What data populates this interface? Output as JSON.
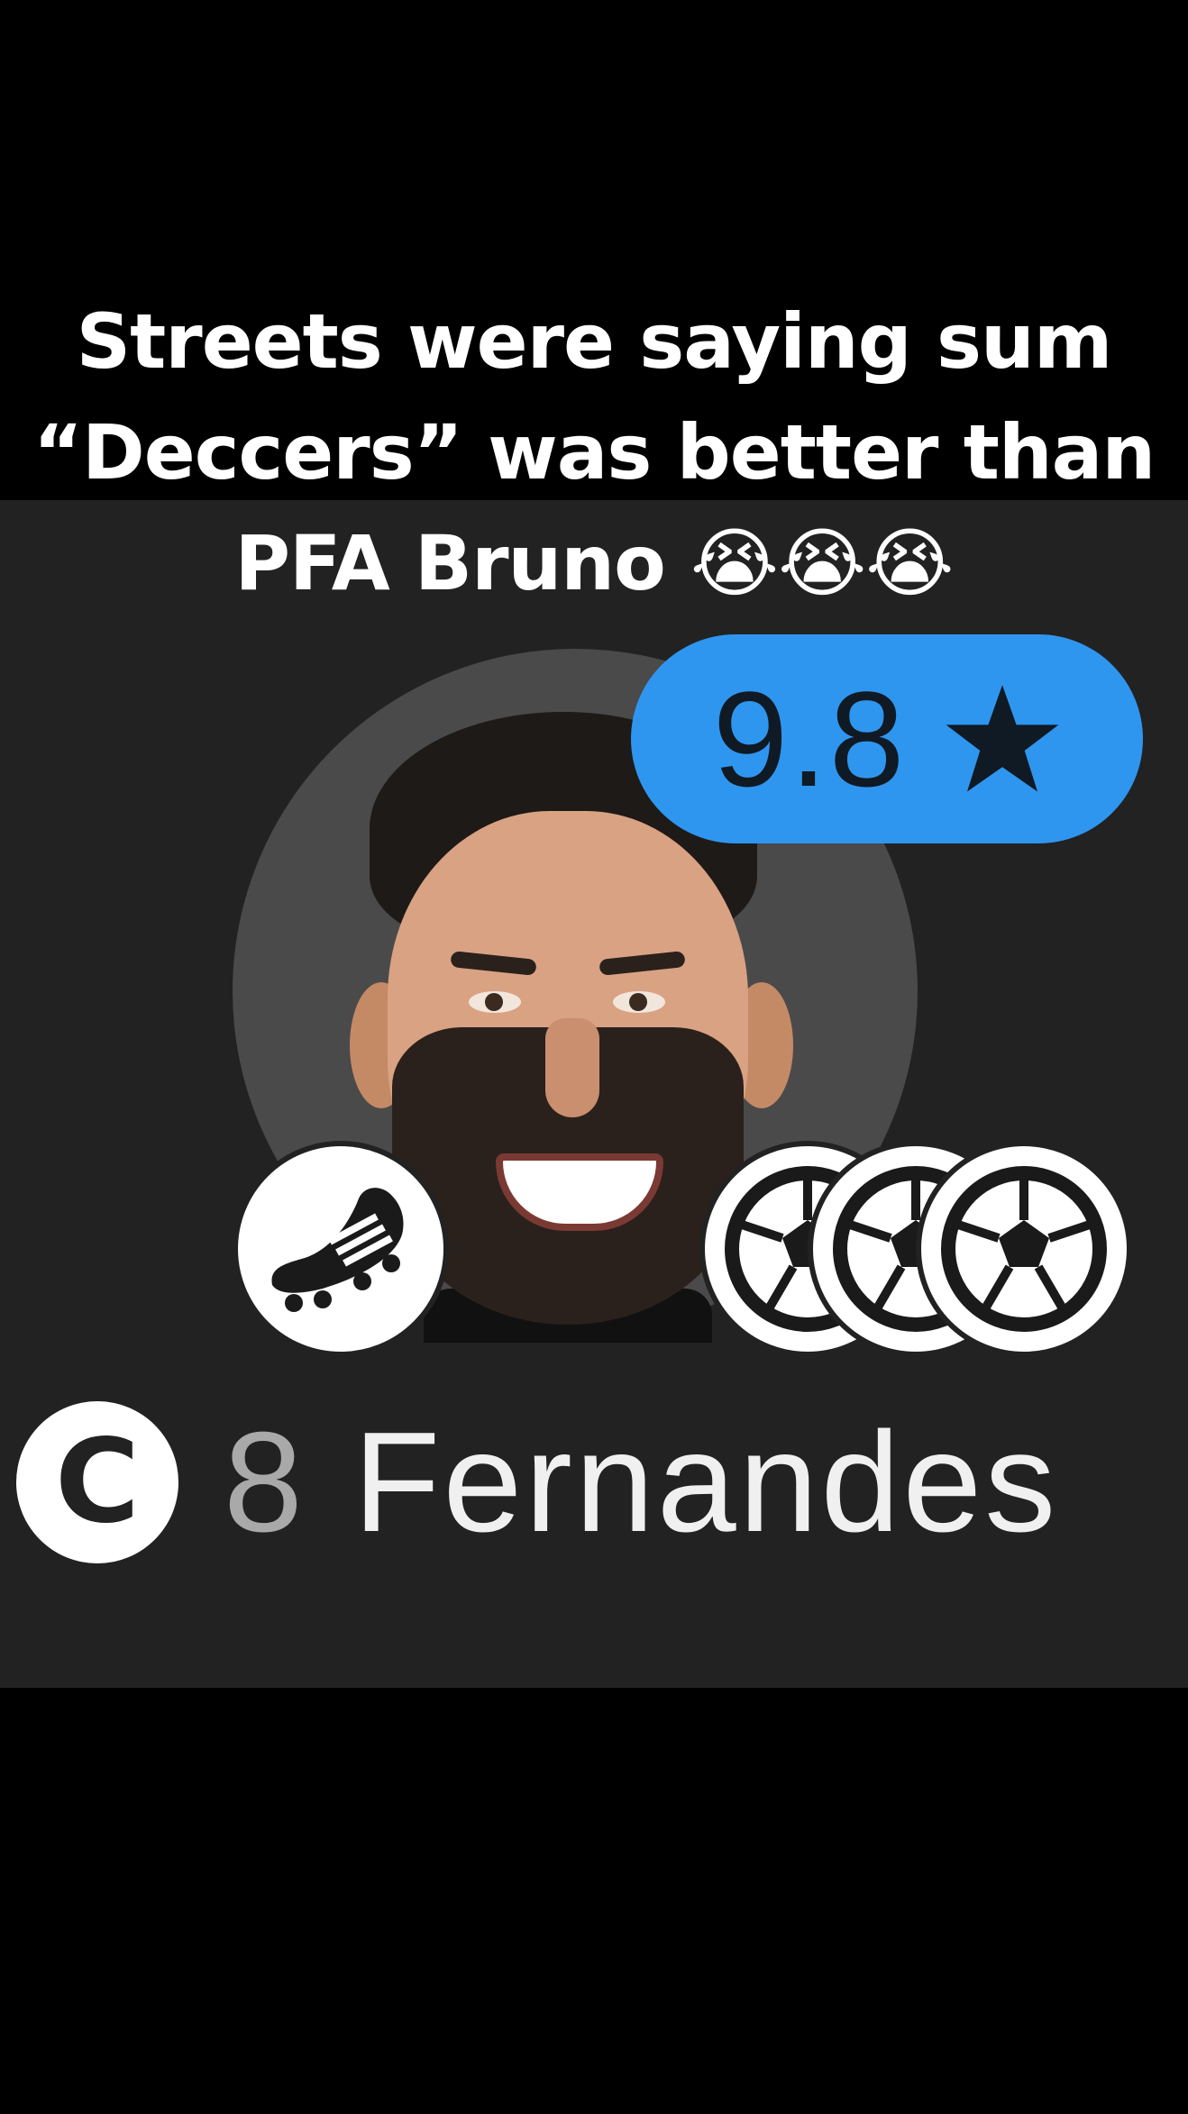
{
  "caption": {
    "line1": "Streets were saying sum",
    "line2": "“Deccers” was better than",
    "line3": "PFA Bruno 😭😭😭"
  },
  "player_card": {
    "rating": "9.8",
    "rating_icon": "star-icon",
    "captain_badge": "C",
    "shirt_number": "8",
    "player_name": "Fernandes",
    "icons": {
      "left": "boot-icon",
      "right": [
        "football-icon",
        "football-icon",
        "football-icon"
      ]
    },
    "goals": 3,
    "assists": 1
  },
  "colors": {
    "panel_background": "#222222",
    "rating_badge": "#2f96ef",
    "page_background": "#000000"
  }
}
